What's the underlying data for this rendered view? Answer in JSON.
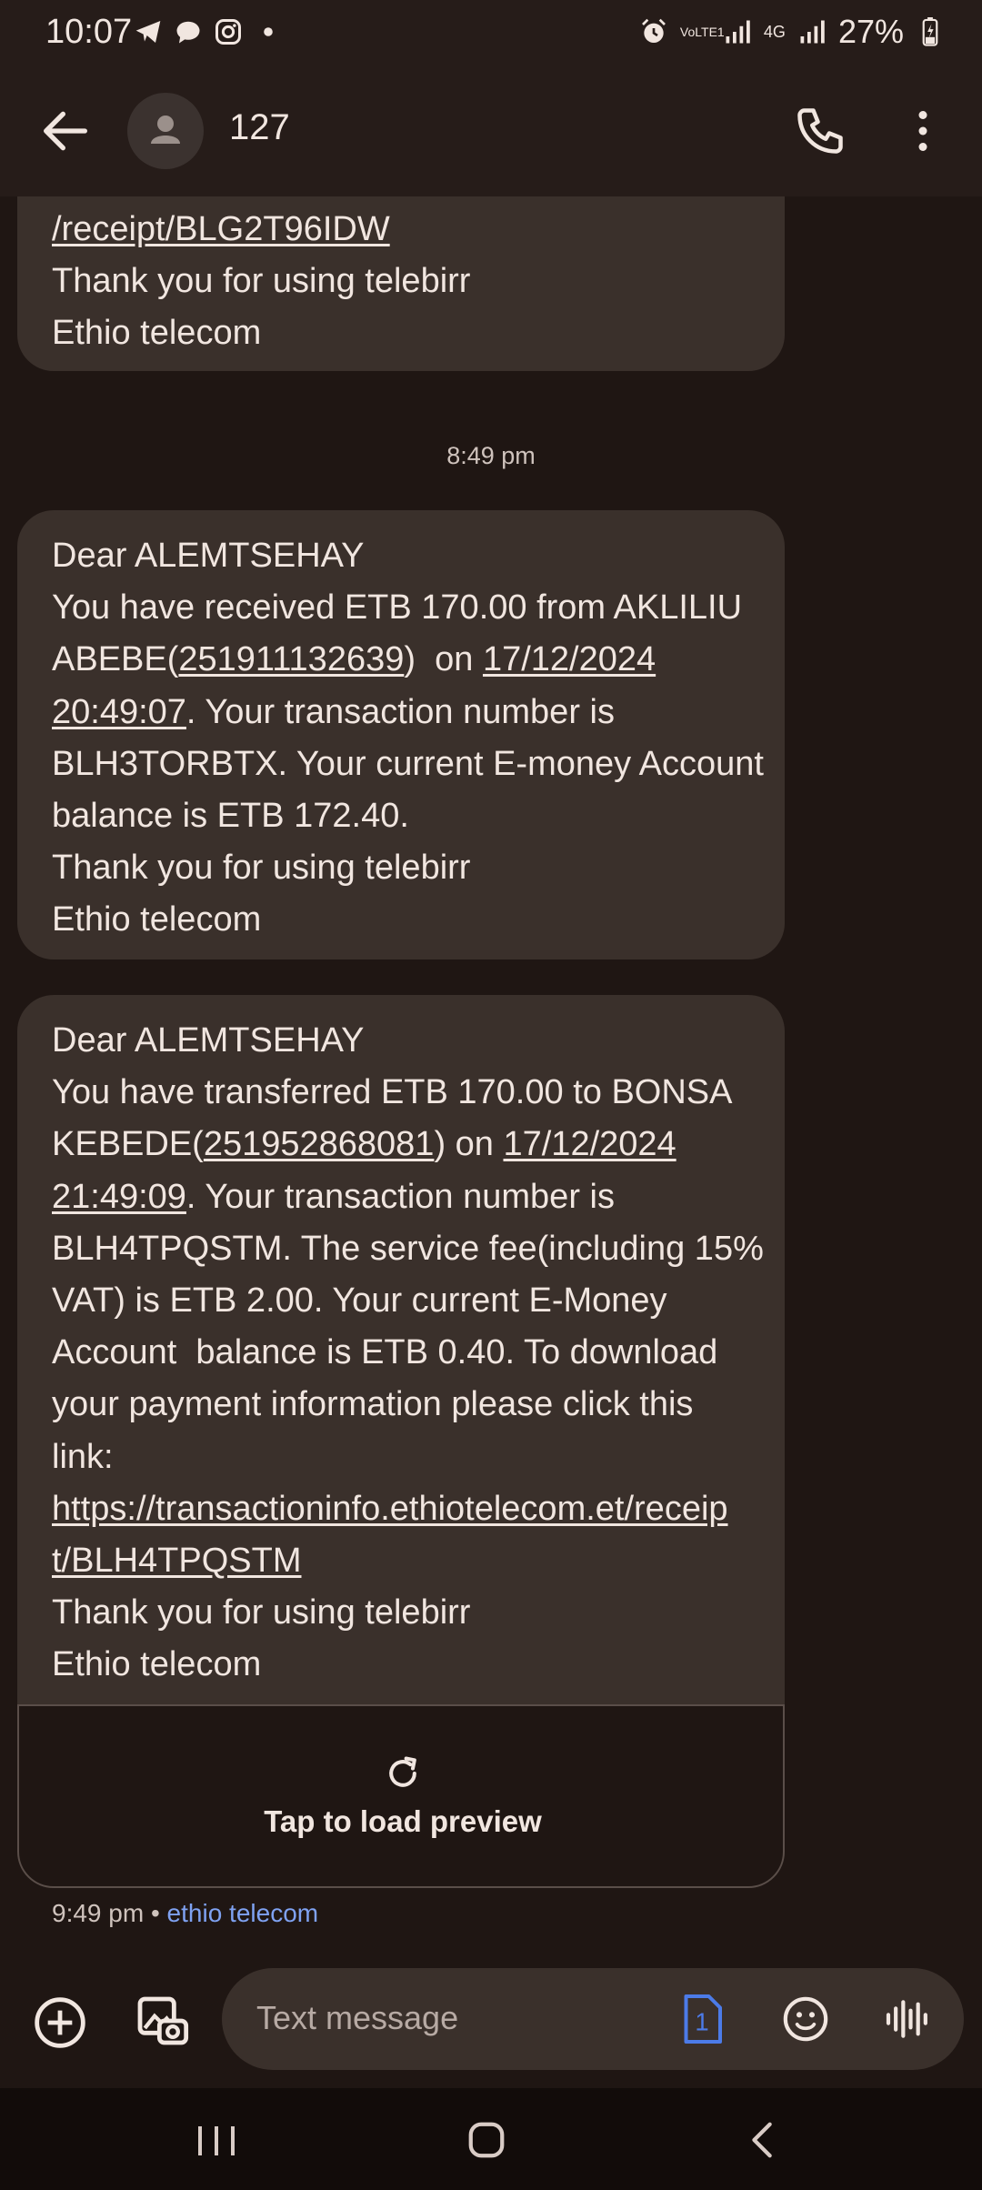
{
  "status_bar": {
    "time": "10:07",
    "battery": "27%",
    "network_volte": "VoLTE1",
    "network_4g": "4G",
    "left_icons": [
      "telegram-icon",
      "chat-bubble-icon",
      "instagram-icon",
      "dot-icon"
    ],
    "right_icons": [
      "alarm-icon",
      "signal-icon",
      "signal-icon",
      "battery-charging-icon"
    ]
  },
  "app_bar": {
    "title": "127",
    "icons": [
      "back-arrow-icon",
      "avatar-person-icon",
      "phone-icon",
      "more-vert-icon"
    ]
  },
  "messages": {
    "partial": {
      "lines": [
        "/receipt/BLG2T96IDW",
        "Thank you for using telebirr",
        "Ethio telecom"
      ]
    },
    "divider_time": "8:49 pm",
    "received": {
      "l1": "Dear ALEMTSEHAY",
      "l2": "You have received ETB 170.00 from AKLILIU",
      "l3a": "ABEBE(",
      "l3_phone": "251911132639",
      "l3b": ")  on ",
      "l3_date": "17/12/2024",
      "l4_time": "20:49:07",
      "l4b": ". Your transaction number is",
      "l5": "BLH3TORBTX. Your current E-money Account",
      "l6": "balance is ETB 172.40.",
      "l7": "Thank you for using telebirr",
      "l8": "Ethio telecom"
    },
    "transferred": {
      "l1": "Dear ALEMTSEHAY",
      "l2": "You have transferred ETB 170.00 to BONSA",
      "l3a": "KEBEDE(",
      "l3_phone": "251952868081",
      "l3b": ") on ",
      "l3_date": "17/12/2024",
      "l4_time": "21:49:09",
      "l4b": ". Your transaction number is",
      "l5": "BLH4TPQSTM. The service fee(including 15%",
      "l6": "VAT) is ETB 2.00. Your current E-Money",
      "l7": "Account  balance is ETB 0.40. To download",
      "l8": "your payment information please click this",
      "l9": "link:",
      "l10": "https://transactioninfo.ethiotelecom.et/receip",
      "l11": "t/BLH4TPQSTM",
      "l12": "Thank you for using telebirr",
      "l13": "Ethio telecom"
    },
    "preview": {
      "label": "Tap to load preview",
      "icon": "refresh-icon"
    },
    "meta": {
      "time": "9:49 pm",
      "sep": " • ",
      "source": "ethio telecom"
    }
  },
  "compose": {
    "placeholder": "Text message",
    "sim_number": "1",
    "icons": [
      "add-circle-icon",
      "gallery-icon",
      "sim-icon",
      "emoji-icon",
      "voice-icon"
    ]
  },
  "nav_bar": {
    "icons": [
      "recent-apps-icon",
      "home-icon",
      "back-icon"
    ]
  },
  "colors": {
    "background": "#1f1613",
    "bubble": "#3a302b",
    "text": "#f1e6e0",
    "link_accent": "#7fa2f2",
    "sim_accent": "#4c7be8"
  }
}
